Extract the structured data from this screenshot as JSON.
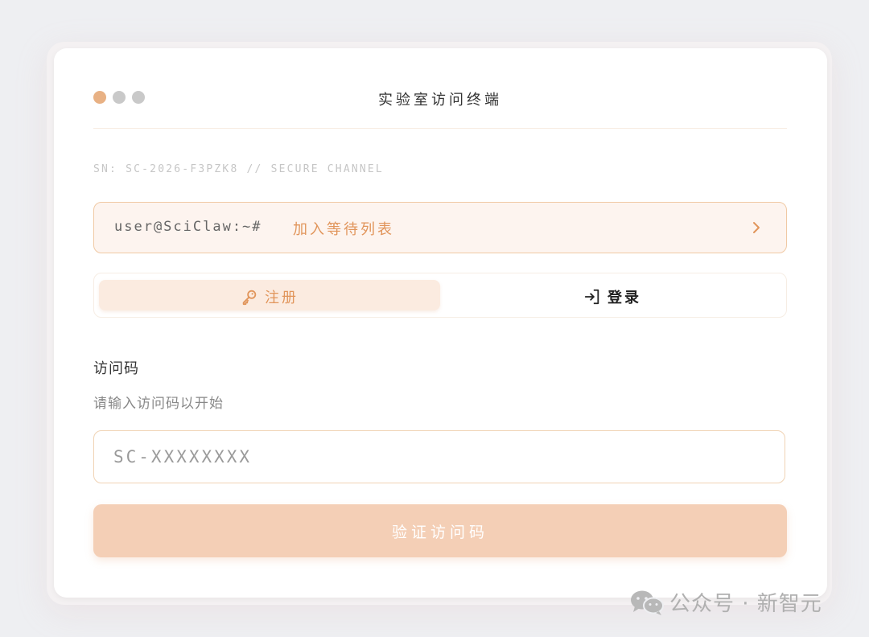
{
  "window": {
    "title": "实验室访问终端"
  },
  "serial": {
    "text": "SN: SC-2026-F3PZK8 // SECURE CHANNEL"
  },
  "waitlist": {
    "prompt": "user@SciClaw:~#",
    "label": "加入等待列表",
    "icon": "chevron-right-icon"
  },
  "tabs": {
    "register": {
      "label": "注册",
      "icon": "key-icon",
      "active": true
    },
    "login": {
      "label": "登录",
      "icon": "login-arrow-icon",
      "active": false
    }
  },
  "form": {
    "label": "访问码",
    "hint": "请输入访问码以开始",
    "placeholder": "SC-XXXXXXXX",
    "value": "",
    "submit_label": "验证访问码"
  },
  "watermark": {
    "text": "公众号 · 新智元",
    "icon": "wechat-icon"
  },
  "colors": {
    "accent": "#e1955b",
    "accent_soft": "#fbebe0",
    "button": "#f4cfb6",
    "border": "#f0c9a4"
  }
}
